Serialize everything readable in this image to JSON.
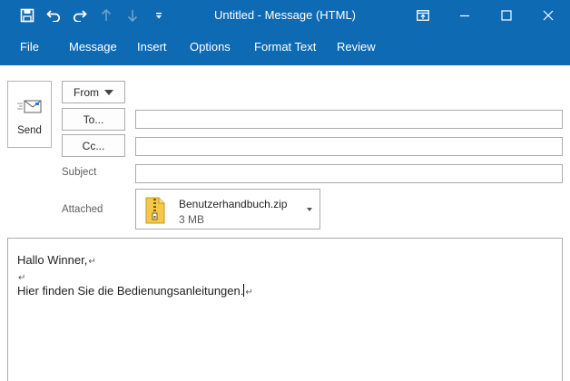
{
  "window": {
    "title": "Untitled  -  Message (HTML)"
  },
  "quick_access": [
    "save-icon",
    "undo-icon",
    "redo-icon",
    "up-arrow-icon",
    "down-arrow-icon",
    "customize-qat-icon"
  ],
  "ribbon": {
    "tabs": [
      "File",
      "Message",
      "Insert",
      "Options",
      "Format Text",
      "Review"
    ]
  },
  "compose": {
    "send_label": "Send",
    "from_label": "From",
    "to_label": "To...",
    "cc_label": "Cc...",
    "subject_label": "Subject",
    "attached_label": "Attached",
    "to_value": "",
    "cc_value": "",
    "subject_value": ""
  },
  "attachment": {
    "name": "Benutzerhandbuch.zip",
    "size": "3 MB"
  },
  "body": {
    "line1": "Hallo Winner,",
    "line2": "",
    "line3": "Hier finden Sie die Bedienungsanleitungen.",
    "paragraph_mark": "↵"
  },
  "colors": {
    "title_bar": "#0f6ab4",
    "accent": "#0f6ab4"
  }
}
